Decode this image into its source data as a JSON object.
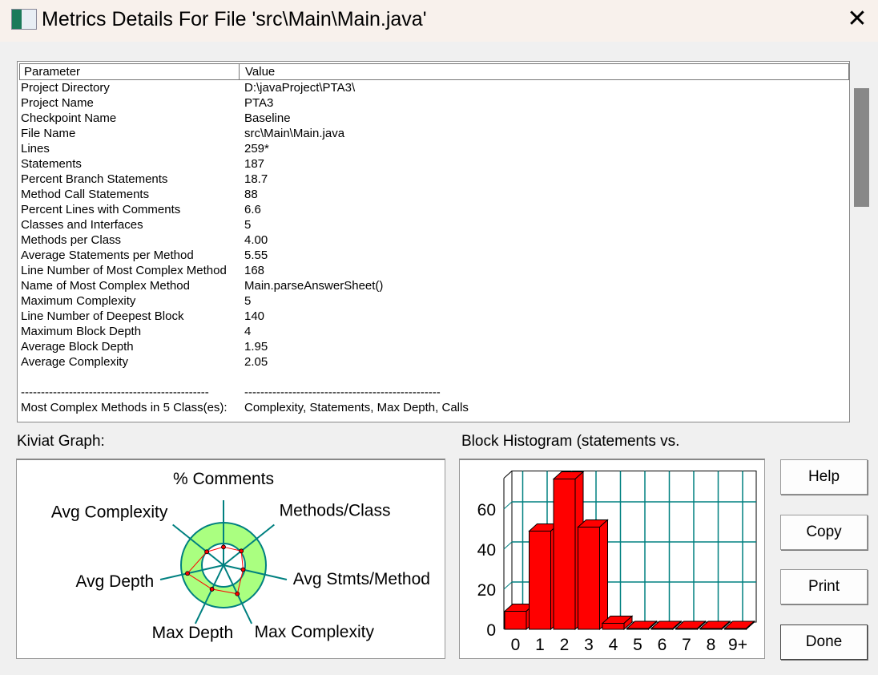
{
  "window": {
    "title": "Metrics Details For File 'src\\Main\\Main.java'",
    "close_icon": "close-icon"
  },
  "table": {
    "headers": [
      "Parameter",
      "Value"
    ],
    "rows": [
      [
        "Project Directory",
        "D:\\javaProject\\PTA3\\"
      ],
      [
        "Project Name",
        "PTA3"
      ],
      [
        "Checkpoint Name",
        "Baseline"
      ],
      [
        "File Name",
        "src\\Main\\Main.java"
      ],
      [
        "Lines",
        "259*"
      ],
      [
        "Statements",
        "187"
      ],
      [
        "Percent Branch Statements",
        "18.7"
      ],
      [
        "Method Call Statements",
        "88"
      ],
      [
        "Percent Lines with Comments",
        "6.6"
      ],
      [
        "Classes and Interfaces",
        "5"
      ],
      [
        "Methods per Class",
        "4.00"
      ],
      [
        "Average Statements per Method",
        "5.55"
      ],
      [
        "Line Number of Most Complex Method",
        "168"
      ],
      [
        "Name of Most Complex Method",
        "Main.parseAnswerSheet()"
      ],
      [
        "Maximum Complexity",
        "5"
      ],
      [
        "Line Number of Deepest Block",
        "140"
      ],
      [
        "Maximum Block Depth",
        "4"
      ],
      [
        "Average Block Depth",
        "1.95"
      ],
      [
        "Average Complexity",
        "2.05"
      ],
      [
        "",
        ""
      ],
      [
        "-----------------------------------------------",
        "-------------------------------------------------"
      ],
      [
        "Most Complex Methods in 5 Class(es):",
        "Complexity, Statements, Max Depth, Calls"
      ]
    ]
  },
  "kiviat": {
    "label": "Kiviat Graph:",
    "axes": [
      "% Comments",
      "Methods/Class",
      "Avg Stmts/Method",
      "Max Complexity",
      "Max Depth",
      "Avg Depth",
      "Avg Complexity"
    ],
    "levels": [
      0.28,
      0.35,
      0.31,
      0.49,
      0.41,
      0.57,
      0.33
    ],
    "band_color": "#aaff80",
    "axis_color": "#008080",
    "line_color": "#ff0000"
  },
  "histogram": {
    "label": "Block Histogram (statements vs.",
    "chart_data": {
      "type": "bar",
      "categories": [
        "0",
        "1",
        "2",
        "3",
        "4",
        "5",
        "6",
        "7",
        "8",
        "9+"
      ],
      "values": [
        9,
        49,
        75,
        51,
        3,
        0,
        0,
        0,
        0,
        0
      ],
      "yticks": [
        0,
        20,
        40,
        60
      ],
      "ylim": [
        0,
        79
      ],
      "bar_color": "#ff0000",
      "grid_color": "#008080"
    }
  },
  "buttons": {
    "help": "Help",
    "copy": "Copy",
    "print": "Print",
    "done": "Done"
  }
}
